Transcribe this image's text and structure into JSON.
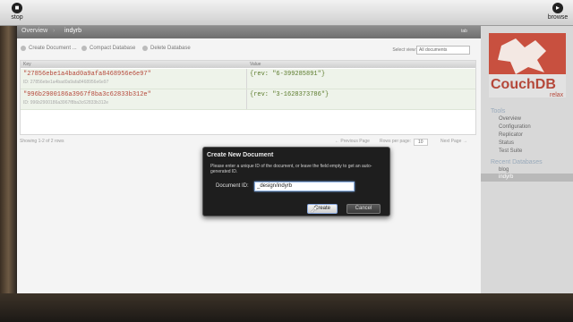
{
  "app_toolbar": {
    "stop_label": "stop",
    "browse_label": "browse"
  },
  "breadcrumb": {
    "overview": "Overview",
    "database": "indyrb",
    "right_link": "tab"
  },
  "db_toolbar": {
    "create_document": "Create Document ...",
    "compact_database": "Compact Database",
    "delete_database": "Delete Database",
    "select_view_label": "Select view:",
    "select_view_value": "All documents"
  },
  "table": {
    "col_key": "Key",
    "col_value": "Value",
    "rows": [
      {
        "key": "\"27856ebe1a4bad0a9afa8468956e6e97\"",
        "id": "ID: 27856ebe1a4bad0a9afa8468956e6e97",
        "value": "{rev: \"6-399285891\"}"
      },
      {
        "key": "\"996b2900186a3967f8ba3c62833b312e\"",
        "id": "ID: 996b2900186a3967f8ba3c62833b312e",
        "value": "{rev: \"3-1628373786\"}"
      }
    ],
    "pager": {
      "showing": "Showing 1-2 of 2 rows",
      "previous": "← Previous Page",
      "rows_per_page": "Rows per page:",
      "rows_value": "10",
      "next": "Next Page →"
    }
  },
  "sidebar": {
    "logo_title": "CouchDB",
    "logo_relax": "relax",
    "tools_heading": "Tools",
    "tools": [
      "Overview",
      "Configuration",
      "Replicator",
      "Status",
      "Test Suite"
    ],
    "recent_heading": "Recent Databases",
    "recent": [
      "blog",
      "indyrb"
    ]
  },
  "dialog": {
    "title": "Create New Document",
    "description": "Please enter a unique ID of the document, or leave the field empty to get an auto-generated ID.",
    "field_label": "Document ID:",
    "field_value": "_design/indyrb",
    "create_button": "Create",
    "cancel_button": "Cancel"
  },
  "colors": {
    "accent": "#b5483a",
    "dialog_bg": "#1e1e1e",
    "focus": "#8db0df"
  }
}
